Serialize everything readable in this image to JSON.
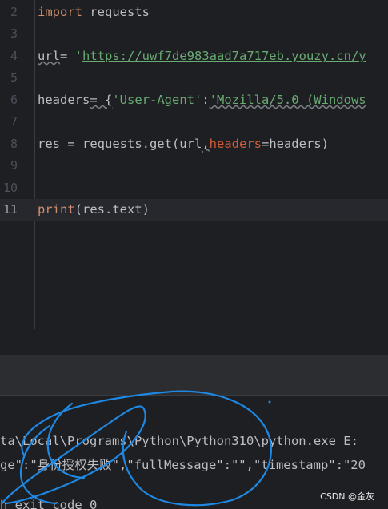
{
  "editor": {
    "lines": [
      {
        "n": "2",
        "kw": "import",
        "rest": " requests"
      },
      {
        "n": "3"
      },
      {
        "n": "4",
        "var": "url",
        "op": "= ",
        "q": "'",
        "url": "https://uwf7de983aad7a717eb.youzy.cn/y"
      },
      {
        "n": "5"
      },
      {
        "n": "6",
        "var": "headers",
        "op": "= {",
        "key": "'User-Agent'",
        "colon": ":",
        "val": "'Mozilla/5.0 (Windows"
      },
      {
        "n": "7"
      },
      {
        "n": "8",
        "pre": "res = requests.get(url",
        "comma": ",",
        "param": "headers",
        "post": "=headers)"
      },
      {
        "n": "9"
      },
      {
        "n": "10"
      },
      {
        "n": "11",
        "fn": "print",
        "args": "(res.text)"
      }
    ]
  },
  "console": {
    "line1": "ta\\Local\\Programs\\Python\\Python310\\python.exe E:",
    "line2": "ge\":\"身份授权失败\",\"fullMessage\":\"\",\"timestamp\":\"20",
    "line3": "h exit code 0"
  },
  "watermark": "CSDN @金灰",
  "colors": {
    "annotation": "#1e88e5",
    "keyword": "#cf8e6d",
    "string": "#6aab73",
    "param": "#d05c3a"
  }
}
